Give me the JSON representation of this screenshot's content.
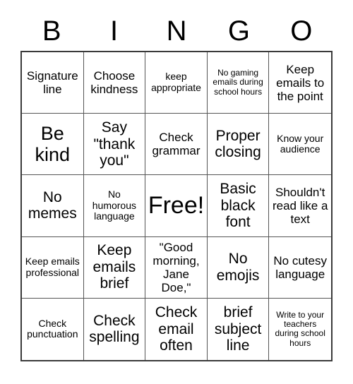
{
  "header": {
    "letters": [
      "B",
      "I",
      "N",
      "G",
      "O"
    ]
  },
  "grid": {
    "rows": 5,
    "columns": 5,
    "cells": [
      {
        "text": "Signature line",
        "size": "fs-sm"
      },
      {
        "text": "Choose kindness",
        "size": "fs-sm"
      },
      {
        "text": "keep appropriate",
        "size": "fs-xs"
      },
      {
        "text": "No gaming emails during school hours",
        "size": "fs-xxs"
      },
      {
        "text": "Keep emails to the point",
        "size": "fs-sm"
      },
      {
        "text": "Be kind",
        "size": "fs-lg"
      },
      {
        "text": "Say \"thank you\"",
        "size": "fs-md"
      },
      {
        "text": "Check grammar",
        "size": "fs-sm"
      },
      {
        "text": "Proper closing",
        "size": "fs-md"
      },
      {
        "text": "Know your audience",
        "size": "fs-xs"
      },
      {
        "text": "No memes",
        "size": "fs-md"
      },
      {
        "text": "No humorous language",
        "size": "fs-xs"
      },
      {
        "text": "Free!",
        "size": "fs-xl"
      },
      {
        "text": "Basic black font",
        "size": "fs-md"
      },
      {
        "text": "Shouldn't read like a text",
        "size": "fs-sm"
      },
      {
        "text": "Keep emails professional",
        "size": "fs-xs"
      },
      {
        "text": "Keep emails brief",
        "size": "fs-md"
      },
      {
        "text": "\"Good morning, Jane Doe,\"",
        "size": "fs-sm"
      },
      {
        "text": "No emojis",
        "size": "fs-md"
      },
      {
        "text": "No cutesy language",
        "size": "fs-sm"
      },
      {
        "text": "Check punctuation",
        "size": "fs-xs"
      },
      {
        "text": "Check spelling",
        "size": "fs-md"
      },
      {
        "text": "Check email often",
        "size": "fs-md"
      },
      {
        "text": "brief subject line",
        "size": "fs-md"
      },
      {
        "text": "Write to your teachers during school hours",
        "size": "fs-xxs"
      }
    ]
  }
}
